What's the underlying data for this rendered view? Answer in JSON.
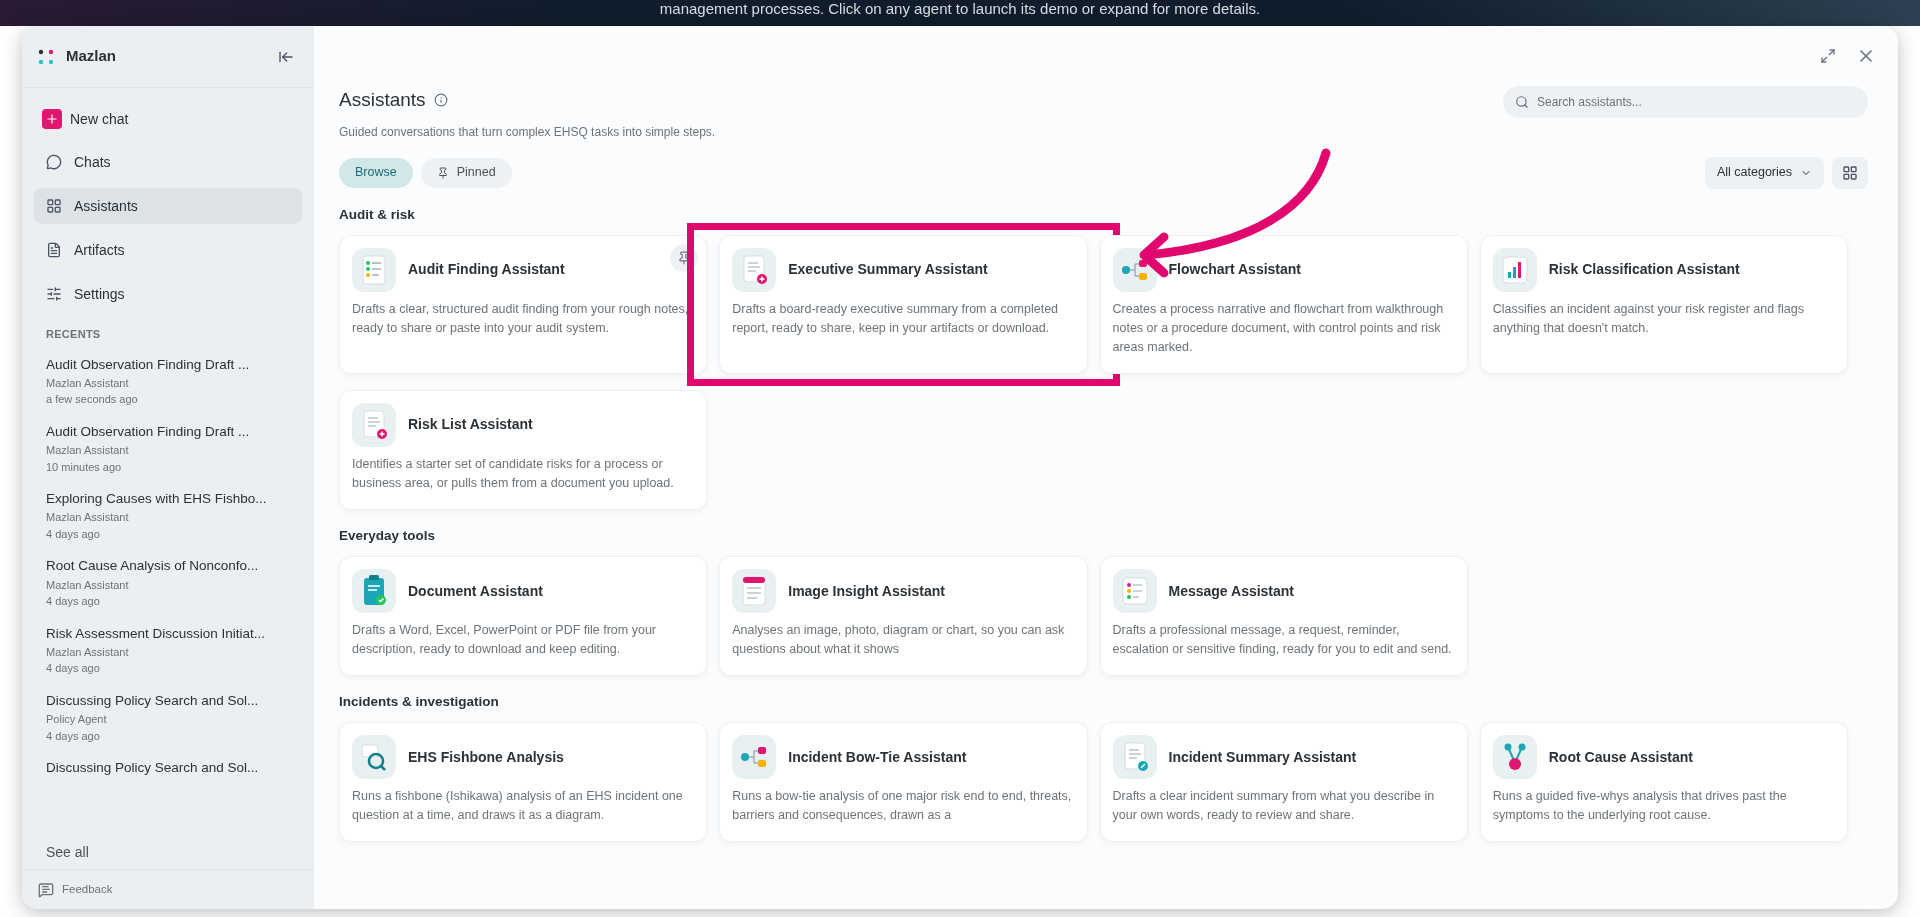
{
  "banner": {
    "text": "management processes. Click on any agent to launch its demo or expand for more details."
  },
  "sidebar": {
    "brand": "Mazlan",
    "new_chat": "New chat",
    "items": [
      {
        "label": "Chats",
        "kind": "chats",
        "selected": false
      },
      {
        "label": "Assistants",
        "kind": "assistants",
        "selected": true
      },
      {
        "label": "Artifacts",
        "kind": "artifacts",
        "selected": false
      },
      {
        "label": "Settings",
        "kind": "settings",
        "selected": false
      }
    ],
    "recents_heading": "RECENTS",
    "recents": [
      {
        "title": "Audit Observation Finding Draft ...",
        "agent": "Mazlan Assistant",
        "time": "a few seconds ago"
      },
      {
        "title": "Audit Observation Finding Draft ...",
        "agent": "Mazlan Assistant",
        "time": "10 minutes ago"
      },
      {
        "title": "Exploring Causes with EHS Fishbo...",
        "agent": "Mazlan Assistant",
        "time": "4 days ago"
      },
      {
        "title": "Root Cause Analysis of Nonconfo...",
        "agent": "Mazlan Assistant",
        "time": "4 days ago"
      },
      {
        "title": "Risk Assessment Discussion Initiat...",
        "agent": "Mazlan Assistant",
        "time": "4 days ago"
      },
      {
        "title": "Discussing Policy Search and Sol...",
        "agent": "Policy Agent",
        "time": "4 days ago"
      },
      {
        "title": "Discussing Policy Search and Sol..."
      }
    ],
    "see_all": "See all",
    "feedback": "Feedback"
  },
  "main": {
    "title": "Assistants",
    "subtitle": "Guided conversations that turn complex EHSQ tasks into simple steps.",
    "search": {
      "placeholder": "Search assistants..."
    },
    "tabs": [
      {
        "label": "Browse",
        "kind": "browse",
        "selected": true
      },
      {
        "label": "Pinned",
        "kind": "pinned",
        "selected": false
      }
    ],
    "category_filter": "All categories",
    "sections": [
      {
        "heading": "Audit & risk",
        "cards": [
          {
            "title": "Audit Finding Assistant",
            "description": "Drafts a clear, structured audit finding from your rough notes, ready to share or paste into your audit system.",
            "kind": "checklist",
            "pin_shown": true,
            "highlighted": false,
            "pointed_at": false
          },
          {
            "title": "Executive Summary Assistant",
            "description": "Drafts a board-ready executive summary from a completed report, ready to share, keep in your artifacts or download.",
            "kind": "doc-plus",
            "pin_shown": false,
            "highlighted": true,
            "pointed_at": false
          },
          {
            "title": "Flowchart Assistant",
            "description": "Creates a process narrative and flowchart from walkthrough notes or a procedure document, with control points and risk areas marked.",
            "kind": "flow",
            "pin_shown": false,
            "highlighted": false,
            "pointed_at": true
          },
          {
            "title": "Risk Classification Assistant",
            "description": "Classifies an incident against your risk register and flags anything that doesn't match.",
            "kind": "bars",
            "pin_shown": false,
            "highlighted": false,
            "pointed_at": false
          },
          {
            "title": "Risk List Assistant",
            "description": "Identifies a starter set of candidate risks for a process or business area, or pulls them from a document you upload.",
            "kind": "doc-plus",
            "pin_shown": false,
            "highlighted": false,
            "pointed_at": false
          }
        ]
      },
      {
        "heading": "Everyday tools",
        "cards": [
          {
            "title": "Document Assistant",
            "description": "Drafts a Word, Excel, PowerPoint or PDF file from your description, ready to download and keep editing.",
            "kind": "clipboard",
            "pin_shown": false,
            "highlighted": false,
            "pointed_at": false
          },
          {
            "title": "Image Insight Assistant",
            "description": "Analyses an image, photo, diagram or chart, so you can ask questions about what it shows",
            "kind": "note",
            "pin_shown": false,
            "highlighted": false,
            "pointed_at": false
          },
          {
            "title": "Message Assistant",
            "description": "Drafts a professional message, a request, reminder, escalation or sensitive finding, ready for you to edit and send.",
            "kind": "list",
            "pin_shown": false,
            "highlighted": false,
            "pointed_at": false
          }
        ]
      },
      {
        "heading": "Incidents & investigation",
        "cards": [
          {
            "title": "EHS Fishbone Analysis",
            "description": "Runs a fishbone (Ishikawa) analysis of an EHS incident one question at a time, and draws it as a diagram.",
            "kind": "magnifier",
            "pin_shown": false,
            "highlighted": false,
            "pointed_at": false
          },
          {
            "title": "Incident Bow-Tie Assistant",
            "description": "Runs a bow-tie analysis of one major risk end to end, threats, barriers and consequences, drawn as a",
            "kind": "flow",
            "pin_shown": false,
            "highlighted": false,
            "pointed_at": false
          },
          {
            "title": "Incident Summary Assistant",
            "description": "Drafts a clear incident summary from what you describe in your own words, ready to review and share.",
            "kind": "doc-pen",
            "pin_shown": false,
            "highlighted": false,
            "pointed_at": false
          },
          {
            "title": "Root Cause Assistant",
            "description": "Runs a guided five-whys analysis that drives past the symptoms to the underlying root cause.",
            "kind": "nodes",
            "pin_shown": false,
            "highlighted": false,
            "pointed_at": false
          }
        ]
      }
    ]
  }
}
